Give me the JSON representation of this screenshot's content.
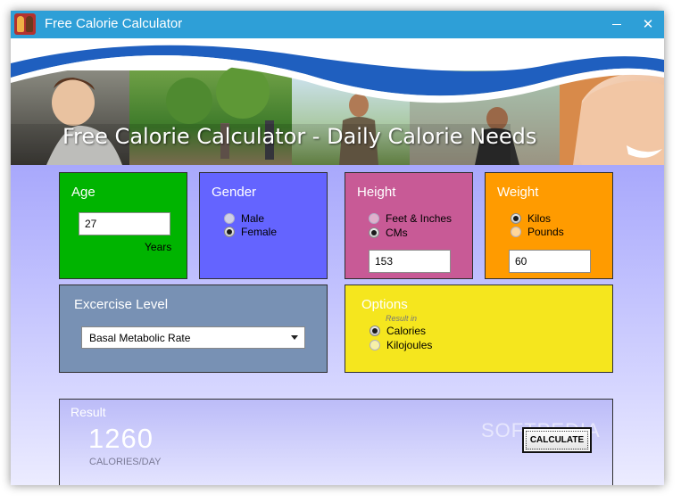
{
  "window": {
    "title": "Free Calorie Calculator",
    "minimize_symbol": "—",
    "close_symbol": "✕"
  },
  "banner": {
    "heading": "Free Calorie Calculator - Daily Calorie Needs"
  },
  "age": {
    "title": "Age",
    "value": "27",
    "unit": "Years",
    "color": "#00b400"
  },
  "gender": {
    "title": "Gender",
    "options": [
      "Male",
      "Female"
    ],
    "selected": "Female",
    "color": "#6464ff"
  },
  "height": {
    "title": "Height",
    "options": [
      "Feet & Inches",
      "CMs"
    ],
    "selected": "CMs",
    "value": "153",
    "color": "#c85a96"
  },
  "weight": {
    "title": "Weight",
    "options": [
      "Kilos",
      "Pounds"
    ],
    "selected": "Kilos",
    "value": "60",
    "color": "#ff9b00"
  },
  "exercise": {
    "title": "Excercise Level",
    "selected": "Basal Metabolic Rate",
    "color": "#7891b4"
  },
  "options": {
    "title": "Options",
    "caption": "Result in",
    "items": [
      "Calories",
      "Kilojoules"
    ],
    "selected": "Calories",
    "color": "#f5e61e"
  },
  "result": {
    "title": "Result",
    "value": "1260",
    "unit": "CALORIES/DAY",
    "calculate_label": "CALCULATE",
    "watermark": "SOFTPEDIA"
  }
}
